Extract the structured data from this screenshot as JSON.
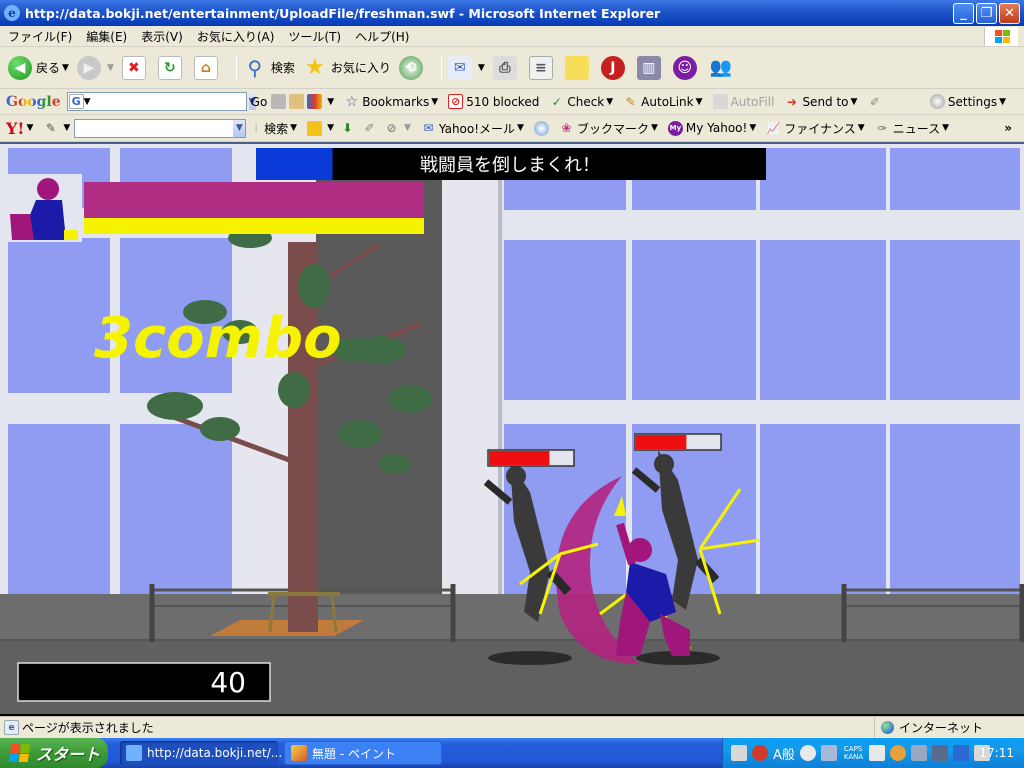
{
  "window": {
    "title": "http://data.bokji.net/entertainment/UploadFile/freshman.swf - Microsoft Internet Explorer",
    "controls": {
      "minimize": "_",
      "maximize": "❐",
      "close": "✕"
    }
  },
  "menu": [
    "ファイル(F)",
    "編集(E)",
    "表示(V)",
    "お気に入り(A)",
    "ツール(T)",
    "ヘルプ(H)"
  ],
  "toolbar": {
    "back_label": "戻る",
    "search_label": "検索",
    "favorites_label": "お気に入り"
  },
  "google_bar": {
    "brand": "Google",
    "search_value": "",
    "go_label": "Go",
    "bookmarks_label": "Bookmarks",
    "blocked_label": "510 blocked",
    "check_label": "Check",
    "autolink_label": "AutoLink",
    "autofill_label": "AutoFill",
    "sendto_label": "Send to",
    "settings_label": "Settings"
  },
  "yahoo_bar": {
    "brand": "Y!",
    "search_value": "",
    "search_label": "検索",
    "mail_label": "Yahoo!メール",
    "bookmark_label": "ブックマーク",
    "myyahoo_label": "My Yahoo!",
    "finance_label": "ファイナンス",
    "news_label": "ニュース",
    "more": "»"
  },
  "game": {
    "mission_text": "戦闘員を倒しまくれ！",
    "combo_text": "3combo",
    "score": "40",
    "player_health": 1.0,
    "player_special": 1.0,
    "mission_progress": 0.15,
    "enemy_health": [
      0.72,
      0.6
    ],
    "colors": {
      "sky": "#8f9cf2",
      "building": "#dfe2ee",
      "ground": "#6d6d6d",
      "hero_purple": "#a0167a",
      "hero_blue": "#1c1aa8",
      "combo": "#f6f300",
      "health": "#b02d84",
      "special": "#f6f300",
      "enemy_bar": "#ee1010"
    }
  },
  "status": {
    "message": "ページが表示されました",
    "zone": "インターネット"
  },
  "taskbar": {
    "start_label": "スタート",
    "tasks": [
      "http://data.bokji.net/...",
      "無題 - ペイント"
    ],
    "ime": "A般",
    "caps": "CAPS",
    "kana": "KANA",
    "clock": "17:11"
  }
}
